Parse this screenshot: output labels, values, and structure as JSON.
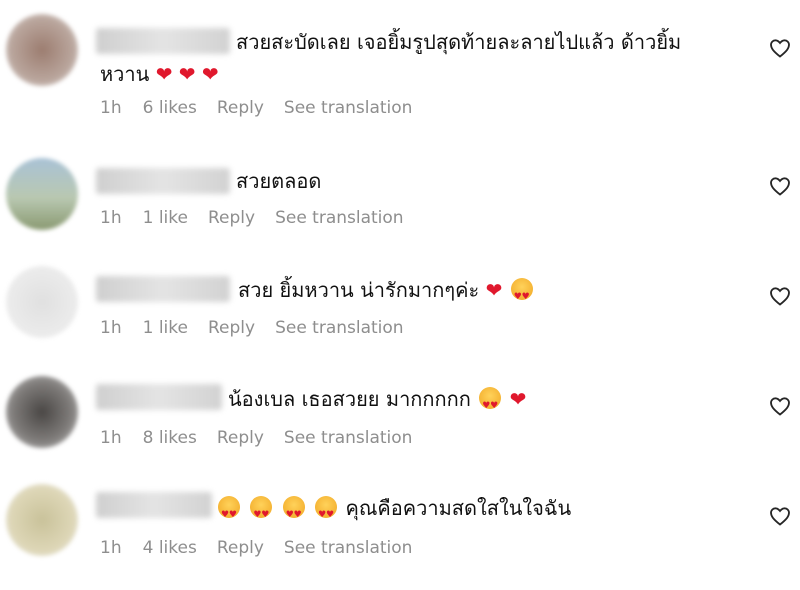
{
  "comments": [
    {
      "text": "สวยสะบัดเลย เจอยิ้มรูปสุดท้ายละลายไปแล้ว ด้าวยิ้ม หวาน",
      "time": "1h",
      "likes": "6 likes",
      "reply": "Reply",
      "translate": "See translation",
      "avatar_color": "#a88e82"
    },
    {
      "text": "สวยตลอด",
      "time": "1h",
      "likes": "1 like",
      "reply": "Reply",
      "translate": "See translation",
      "avatar_color": "#b7c7cf"
    },
    {
      "text": "สวย ยิ้มหวาน น่ารักมากๆค่ะ",
      "time": "1h",
      "likes": "1 like",
      "reply": "Reply",
      "translate": "See translation",
      "avatar_color": "#e8e8e8"
    },
    {
      "text": "น้องเบล เธอสวยย มากกกกก",
      "time": "1h",
      "likes": "8 likes",
      "reply": "Reply",
      "translate": "See translation",
      "avatar_color": "#6f6c6b"
    },
    {
      "text": "คุณคือความสดใสในใจฉัน",
      "time": "1h",
      "likes": "4 likes",
      "reply": "Reply",
      "translate": "See translation",
      "avatar_color": "#d6d0b4"
    }
  ],
  "icons": {
    "like": "heart-outline-icon"
  }
}
